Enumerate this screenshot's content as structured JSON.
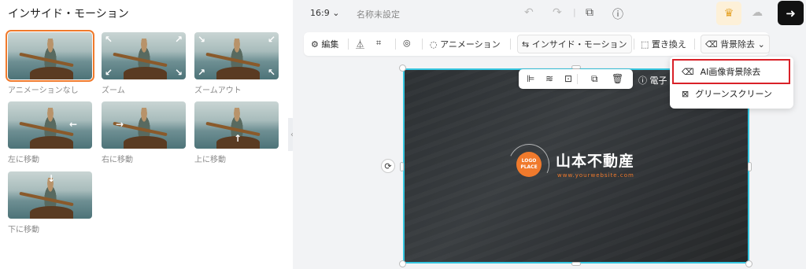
{
  "left_panel": {
    "title": "インサイド・モーション",
    "effects": [
      {
        "label": "アニメーションなし",
        "selected": true,
        "icon": "none"
      },
      {
        "label": "ズーム",
        "selected": false,
        "icon": "zoom-in-arrows-icon"
      },
      {
        "label": "ズームアウト",
        "selected": false,
        "icon": "zoom-out-arrows-icon"
      },
      {
        "label": "左に移動",
        "selected": false,
        "icon": "arrow-left-icon"
      },
      {
        "label": "右に移動",
        "selected": false,
        "icon": "arrow-right-icon"
      },
      {
        "label": "上に移動",
        "selected": false,
        "icon": "arrow-up-icon"
      },
      {
        "label": "下に移動",
        "selected": false,
        "icon": "arrow-down-icon"
      }
    ]
  },
  "topbar": {
    "ratio": "16:9",
    "doc_name": "名称未設定"
  },
  "toolbar": {
    "edit": "編集",
    "animation": "アニメーション",
    "inside_motion": "インサイド・モーション",
    "replace": "置き換え",
    "remove_bg": "背景除去"
  },
  "dropdown": {
    "ai_remove": "AI画像背景除去",
    "green_screen": "グリーンスクリーン"
  },
  "canvas": {
    "warning_label": "電子",
    "logo_text_line1": "LOGO",
    "logo_text_line2": "PLACE",
    "company_name": "山本不動産",
    "website": "www.yourwebsite.com"
  },
  "colors": {
    "accent_orange": "#f07a2c",
    "selection_cyan": "#35c6e0",
    "highlight_red": "#d92128"
  }
}
